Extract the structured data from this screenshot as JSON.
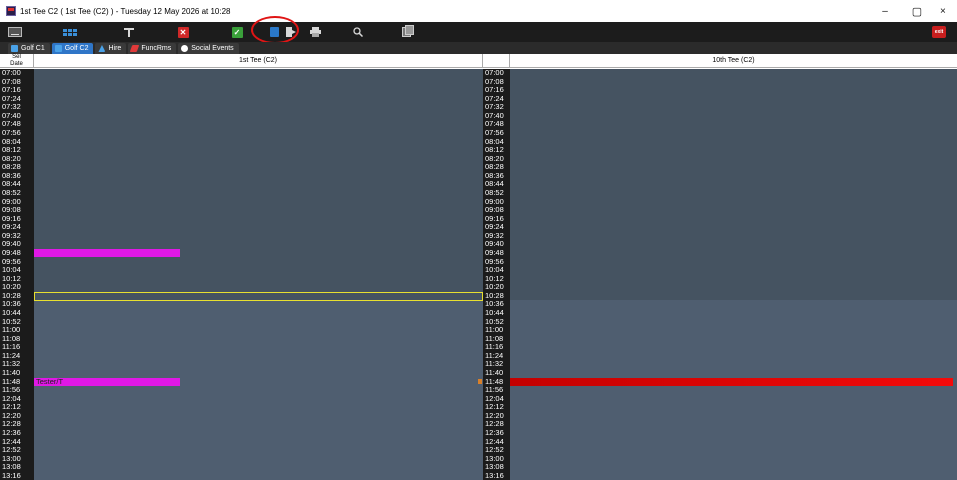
{
  "window": {
    "title": "1st Tee C2 ( 1st Tee (C2) ) - Tuesday 12 May 2026 at 10:28",
    "minimize": "–",
    "maximize": "▢",
    "close": "×"
  },
  "toolbar": {
    "icons": [
      "keyboard-icon",
      "grid-icon",
      "filter-icon",
      "close-icon",
      "check-icon",
      "exit-door-icon",
      "sheet-icon",
      "print-icon",
      "search-icon",
      "copy-icon",
      "exit-app-icon"
    ],
    "exit_label": "exit",
    "highlighted_icon": "sheet-icon",
    "highlight_color": "#e01515"
  },
  "tabs": [
    {
      "label": "Golf C1",
      "icon": "golf-icon",
      "active": false
    },
    {
      "label": "Golf C2",
      "icon": "golf-icon",
      "active": true
    },
    {
      "label": "Hire",
      "icon": "hire-icon",
      "active": false
    },
    {
      "label": "FuncRms",
      "icon": "function-rooms-icon",
      "active": false
    },
    {
      "label": "Social Events",
      "icon": "social-icon",
      "active": false
    }
  ],
  "grid": {
    "date_header": "Sel\nDate",
    "columns": [
      "1st Tee (C2)",
      "10th Tee (C2)"
    ],
    "times": [
      "07:00",
      "07:08",
      "07:16",
      "07:24",
      "07:32",
      "07:40",
      "07:48",
      "07:56",
      "08:04",
      "08:12",
      "08:20",
      "08:28",
      "08:36",
      "08:44",
      "08:52",
      "09:00",
      "09:08",
      "09:16",
      "09:24",
      "09:32",
      "09:40",
      "09:48",
      "09:56",
      "10:04",
      "10:12",
      "10:20",
      "10:28",
      "10:36",
      "10:44",
      "10:52",
      "11:00",
      "11:08",
      "11:16",
      "11:24",
      "11:32",
      "11:40",
      "11:48",
      "11:56",
      "12:04",
      "12:12",
      "12:20",
      "12:28",
      "12:36",
      "12:44",
      "12:52",
      "13:00",
      "13:08",
      "13:16"
    ],
    "current_time": "10:28",
    "bookings": [
      {
        "column": 0,
        "time": "09:48",
        "label": "",
        "color": "#e018e6",
        "width_fraction": 0.325
      },
      {
        "column": 0,
        "time": "11:48",
        "label": "Tester/T",
        "color": "#e018e6",
        "width_fraction": 0.325
      },
      {
        "column": 1,
        "time": "11:48",
        "label": "",
        "color": "#e00000",
        "width_fraction": 0.99
      }
    ],
    "colors": {
      "past": "#455361",
      "future": "#4f5e70",
      "current_outline": "#e8e030",
      "time_bg": "#1b1b1b"
    }
  }
}
